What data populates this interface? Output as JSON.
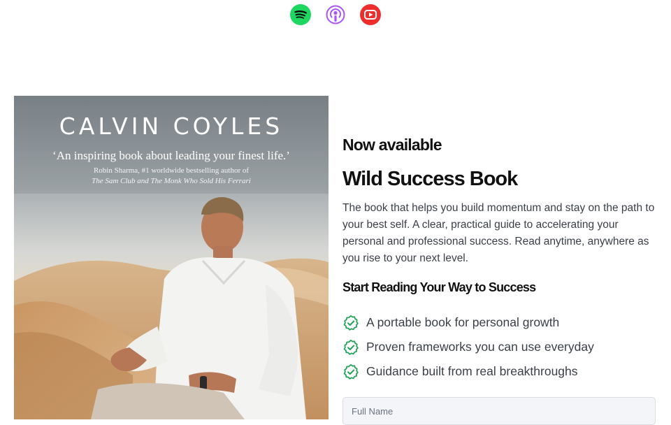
{
  "podcast_links": [
    {
      "icon": "spotify-icon",
      "color": "#1ed760"
    },
    {
      "icon": "apple-podcasts-icon",
      "color": "#a855f7"
    },
    {
      "icon": "youtube-icon",
      "color": "#ee2d2d"
    }
  ],
  "book_cover": {
    "author": "CALVIN COYLES",
    "quote": "‘An inspiring book about leading your finest life.’",
    "endorser": "Robin Sharma, #1 worldwide bestselling author of",
    "endorser_titles": "The Sam Club and The Monk Who Sold His Ferrari"
  },
  "promo": {
    "kicker": "Now available",
    "title": "Wild Success Book",
    "description": "The book that helps you build momentum and stay on the path to your best self. A clear, practical guide to accelerating your personal and professional success. Read anytime, anywhere as you rise to your next level.",
    "subhead": "Start Reading Your Way to Success",
    "benefits": [
      "A portable book for personal growth",
      "Proven frameworks you can use everyday",
      "Guidance built from real breakthroughs"
    ],
    "check_color": "#22a35a"
  },
  "form": {
    "full_name_placeholder": "Full Name"
  }
}
